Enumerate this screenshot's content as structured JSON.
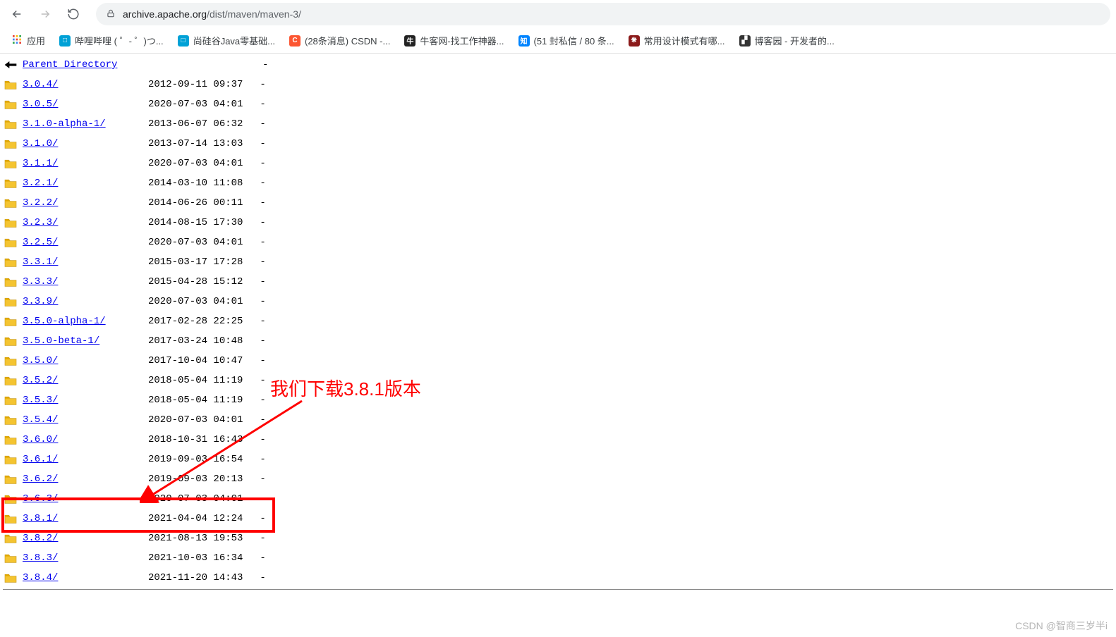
{
  "toolbar": {
    "url_host": "archive.apache.org",
    "url_path": "/dist/maven/maven-3/"
  },
  "bookmarks": {
    "apps_label": "应用",
    "items": [
      {
        "label": "哔哩哔哩 (  ゜- ゜)つ...",
        "color": "#00a1d6",
        "glyph": "□"
      },
      {
        "label": "尚硅谷Java零基础...",
        "color": "#00a1d6",
        "glyph": "□"
      },
      {
        "label": "(28条消息) CSDN -...",
        "color": "#fc5531",
        "glyph": "C"
      },
      {
        "label": "牛客网-找工作神器...",
        "color": "#222",
        "glyph": "牛"
      },
      {
        "label": "(51 封私信 / 80 条...",
        "color": "#0084ff",
        "glyph": "知"
      },
      {
        "label": "常用设计模式有哪...",
        "color": "#8b1a1a",
        "glyph": "❋"
      },
      {
        "label": "博客园 - 开发者的...",
        "color": "#333",
        "glyph": "▞"
      }
    ]
  },
  "listing": {
    "parent_label": "Parent Directory",
    "parent_size": "-",
    "rows": [
      {
        "name": "3.0.4/",
        "date": "2012-09-11 09:37",
        "size": "-"
      },
      {
        "name": "3.0.5/",
        "date": "2020-07-03 04:01",
        "size": "-"
      },
      {
        "name": "3.1.0-alpha-1/",
        "date": "2013-06-07 06:32",
        "size": "-"
      },
      {
        "name": "3.1.0/",
        "date": "2013-07-14 13:03",
        "size": "-"
      },
      {
        "name": "3.1.1/",
        "date": "2020-07-03 04:01",
        "size": "-"
      },
      {
        "name": "3.2.1/",
        "date": "2014-03-10 11:08",
        "size": "-"
      },
      {
        "name": "3.2.2/",
        "date": "2014-06-26 00:11",
        "size": "-"
      },
      {
        "name": "3.2.3/",
        "date": "2014-08-15 17:30",
        "size": "-"
      },
      {
        "name": "3.2.5/",
        "date": "2020-07-03 04:01",
        "size": "-"
      },
      {
        "name": "3.3.1/",
        "date": "2015-03-17 17:28",
        "size": "-"
      },
      {
        "name": "3.3.3/",
        "date": "2015-04-28 15:12",
        "size": "-"
      },
      {
        "name": "3.3.9/",
        "date": "2020-07-03 04:01",
        "size": "-"
      },
      {
        "name": "3.5.0-alpha-1/",
        "date": "2017-02-28 22:25",
        "size": "-"
      },
      {
        "name": "3.5.0-beta-1/",
        "date": "2017-03-24 10:48",
        "size": "-"
      },
      {
        "name": "3.5.0/",
        "date": "2017-10-04 10:47",
        "size": "-"
      },
      {
        "name": "3.5.2/",
        "date": "2018-05-04 11:19",
        "size": "-"
      },
      {
        "name": "3.5.3/",
        "date": "2018-05-04 11:19",
        "size": "-"
      },
      {
        "name": "3.5.4/",
        "date": "2020-07-03 04:01",
        "size": "-"
      },
      {
        "name": "3.6.0/",
        "date": "2018-10-31 16:43",
        "size": "-"
      },
      {
        "name": "3.6.1/",
        "date": "2019-09-03 16:54",
        "size": "-"
      },
      {
        "name": "3.6.2/",
        "date": "2019-09-03 20:13",
        "size": "-"
      },
      {
        "name": "3.6.3/",
        "date": "2020-07-03 04:01",
        "size": "-"
      },
      {
        "name": "3.8.1/",
        "date": "2021-04-04 12:24",
        "size": "-"
      },
      {
        "name": "3.8.2/",
        "date": "2021-08-13 19:53",
        "size": "-"
      },
      {
        "name": "3.8.3/",
        "date": "2021-10-03 16:34",
        "size": "-"
      },
      {
        "name": "3.8.4/",
        "date": "2021-11-20 14:43",
        "size": "-"
      }
    ]
  },
  "annotation": {
    "text": "我们下载3.8.1版本"
  },
  "watermark": "CSDN @智商三岁半i"
}
